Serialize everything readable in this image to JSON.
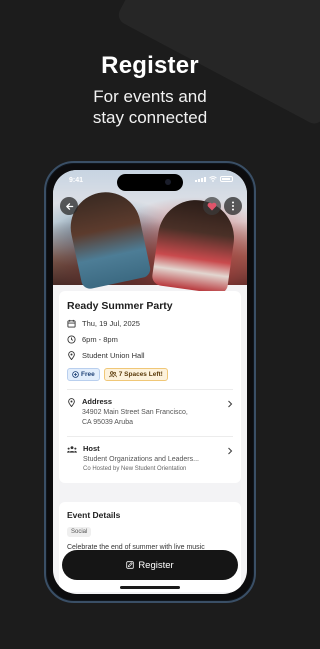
{
  "promo": {
    "headline": "Register",
    "sub_line1": "For events and",
    "sub_line2": "stay connected"
  },
  "status_bar": {
    "time": "9:41"
  },
  "event": {
    "title": "Ready Summer Party",
    "date": "Thu, 19 Jul, 2025",
    "time": "6pm - 8pm",
    "location": "Student Union Hall",
    "chips": {
      "free": "Free",
      "spaces": "7 Spaces Left!"
    },
    "address": {
      "label": "Address",
      "line1": "34902 Main Street San Francisco,",
      "line2": "CA 95039 Aruba"
    },
    "host": {
      "label": "Host",
      "name": "Student Organizations and Leaders...",
      "cohost": "Co Hosted by New Student Orientation"
    }
  },
  "details": {
    "title": "Event Details",
    "tag": "Social",
    "description": "Celebrate the end of summer with live music"
  },
  "cta": {
    "register_label": "Register"
  },
  "colors": {
    "background": "#1c1c1c",
    "phone_frame": "#3a4f66",
    "free_chip": "#e3eefc",
    "spaces_chip": "#fdf2dc",
    "button": "#151515",
    "heart": "#e0546a"
  },
  "icons": [
    "back-arrow-icon",
    "heart-icon",
    "more-vertical-icon",
    "calendar-icon",
    "clock-icon",
    "location-pin-icon",
    "plus-circle-icon",
    "people-icon",
    "chevron-right-icon",
    "group-icon",
    "edit-square-icon"
  ]
}
